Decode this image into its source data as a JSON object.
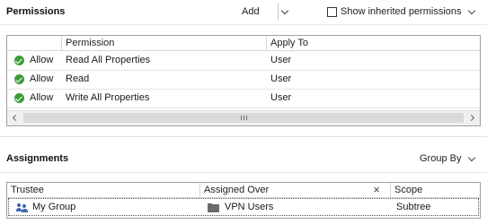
{
  "permissions": {
    "title": "Permissions",
    "add_label": "Add",
    "show_inherited_label": "Show inherited permissions",
    "show_inherited_checked": false,
    "columns": [
      "",
      "Permission",
      "Apply To"
    ],
    "rows": [
      {
        "type": "Allow",
        "permission": "Read All Properties",
        "apply_to": "User"
      },
      {
        "type": "Allow",
        "permission": "Read",
        "apply_to": "User"
      },
      {
        "type": "Allow",
        "permission": "Write All Properties",
        "apply_to": "User"
      }
    ]
  },
  "assignments": {
    "title": "Assignments",
    "group_by_label": "Group By",
    "columns": [
      "Trustee",
      "Assigned Over",
      "Scope"
    ],
    "rows": [
      {
        "trustee": "My Group",
        "assigned_over": "VPN Users",
        "scope": "Subtree"
      }
    ]
  },
  "colors": {
    "allow_green": "#3f9b3a",
    "group_icon_blue": "#3a67b0"
  },
  "icons": {
    "allow": "check-circle-icon",
    "trustee": "user-group-icon",
    "assigned_over": "folder-icon",
    "clear_column": "close-icon"
  }
}
